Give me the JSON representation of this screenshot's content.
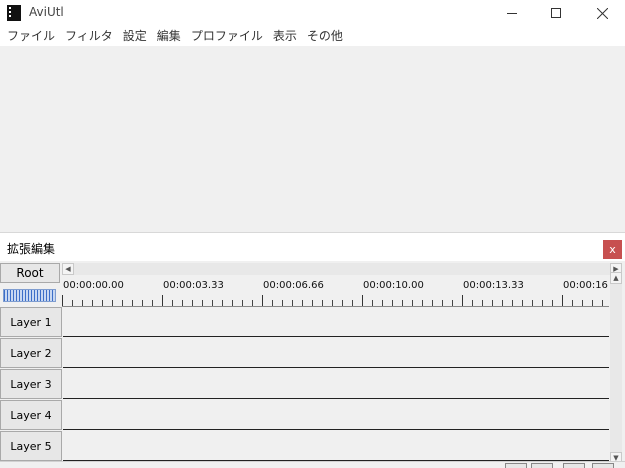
{
  "window": {
    "title": "AviUtl"
  },
  "menu": [
    "ファイル",
    "フィルタ",
    "設定",
    "編集",
    "プロファイル",
    "表示",
    "その他"
  ],
  "timeline": {
    "title": "拡張編集",
    "close_label": "x",
    "root_label": "Root",
    "ruler_labels": [
      "00:00:00.00",
      "00:00:03.33",
      "00:00:06.66",
      "00:00:10.00",
      "00:00:13.33",
      "00:00:16"
    ],
    "layers": [
      "Layer 1",
      "Layer 2",
      "Layer 3",
      "Layer 4",
      "Layer 5"
    ]
  }
}
